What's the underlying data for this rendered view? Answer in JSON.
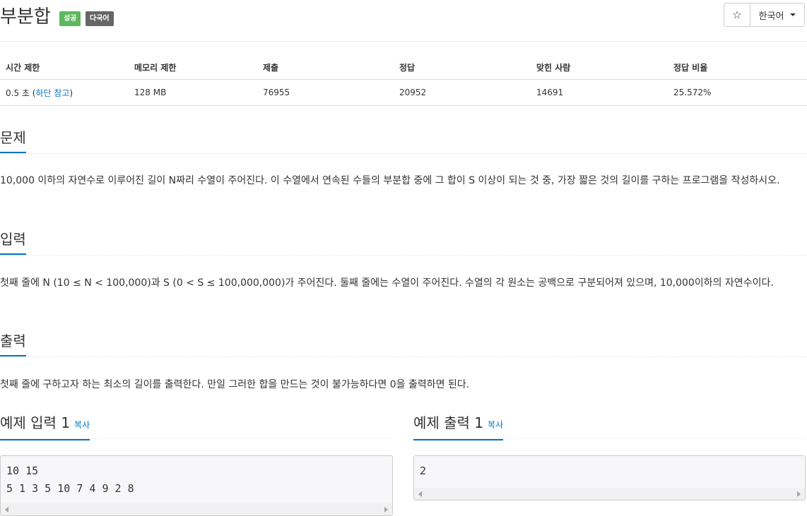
{
  "header": {
    "title": "부분합",
    "badges": [
      "성공",
      "다국어"
    ],
    "star_icon": "☆",
    "language": "한국어"
  },
  "info_table": {
    "headers": [
      "시간 제한",
      "메모리 제한",
      "제출",
      "정답",
      "맞힌 사람",
      "정답 비율"
    ],
    "time_limit_prefix": "0.5 초 (",
    "time_limit_link": "하단 참고",
    "time_limit_suffix": ")",
    "memory": "128 MB",
    "submissions": "76955",
    "accepted": "20952",
    "solvers": "14691",
    "ratio": "25.572%"
  },
  "sections": {
    "problem": {
      "title": "문제",
      "text": "10,000 이하의 자연수로 이루어진 길이 N짜리 수열이 주어진다. 이 수열에서 연속된 수들의 부분합 중에 그 합이 S 이상이 되는 것 중, 가장 짧은 것의 길이를 구하는 프로그램을 작성하시오."
    },
    "input": {
      "title": "입력",
      "text": "첫째 줄에 N (10 ≤ N < 100,000)과 S (0 < S ≤ 100,000,000)가 주어진다. 둘째 줄에는 수열이 주어진다. 수열의 각 원소는 공백으로 구분되어져 있으며, 10,000이하의 자연수이다."
    },
    "output": {
      "title": "출력",
      "text": "첫째 줄에 구하고자 하는 최소의 길이를 출력한다. 만일 그러한 합을 만드는 것이 불가능하다면 0을 출력하면 된다."
    }
  },
  "examples": {
    "input": {
      "title": "예제 입력 1",
      "copy_label": "복사",
      "content": "10 15\n5 1 3 5 10 7 4 9 2 8"
    },
    "output": {
      "title": "예제 출력 1",
      "copy_label": "복사",
      "content": "2"
    }
  },
  "colors": {
    "link": "#0076c0",
    "badge_success": "#5cb85c",
    "badge_multilang": "#666666"
  }
}
